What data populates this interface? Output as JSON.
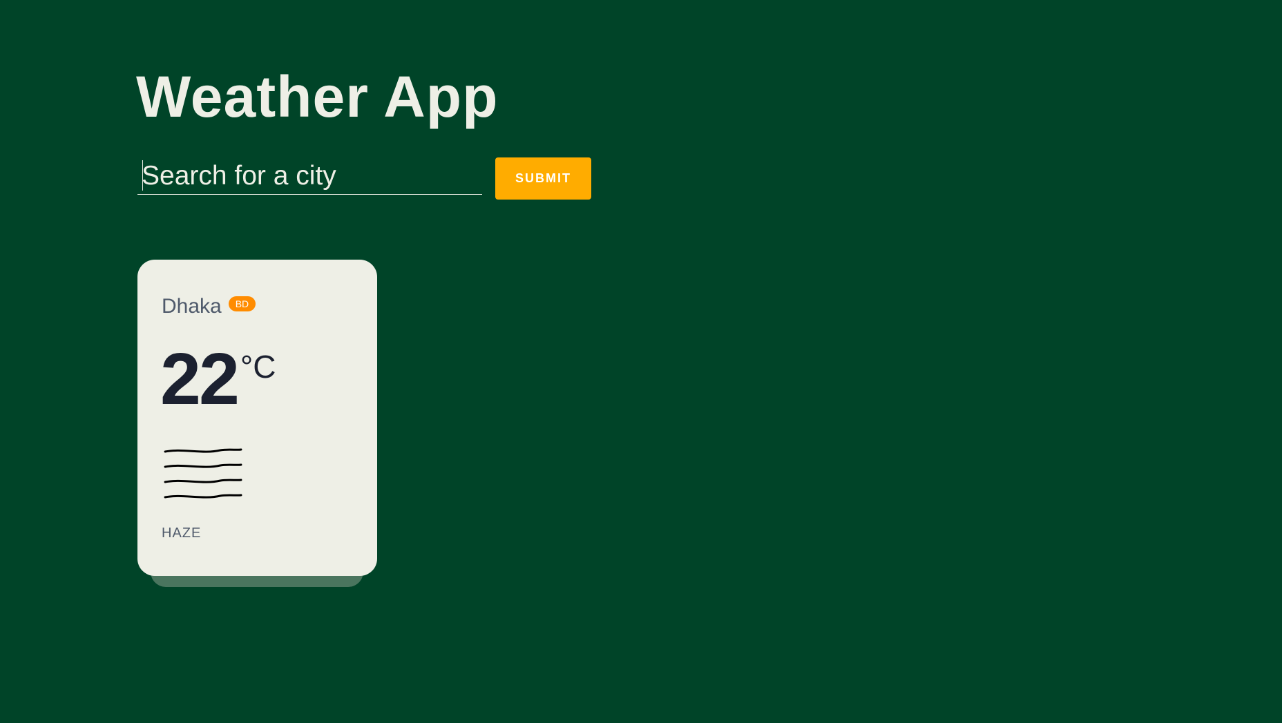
{
  "app": {
    "title": "Weather App"
  },
  "search": {
    "placeholder": "Search for a city",
    "value": "",
    "submit_label": "SUBMIT"
  },
  "weather_card": {
    "city": "Dhaka",
    "country_code": "BD",
    "temperature": "22",
    "unit": "°C",
    "condition": "HAZE",
    "icon": "haze-icon"
  },
  "colors": {
    "background": "#004428",
    "text_light": "#eeefe6",
    "accent_button": "#ffac00",
    "badge": "#ff8c00",
    "card": "#eeefe6"
  }
}
